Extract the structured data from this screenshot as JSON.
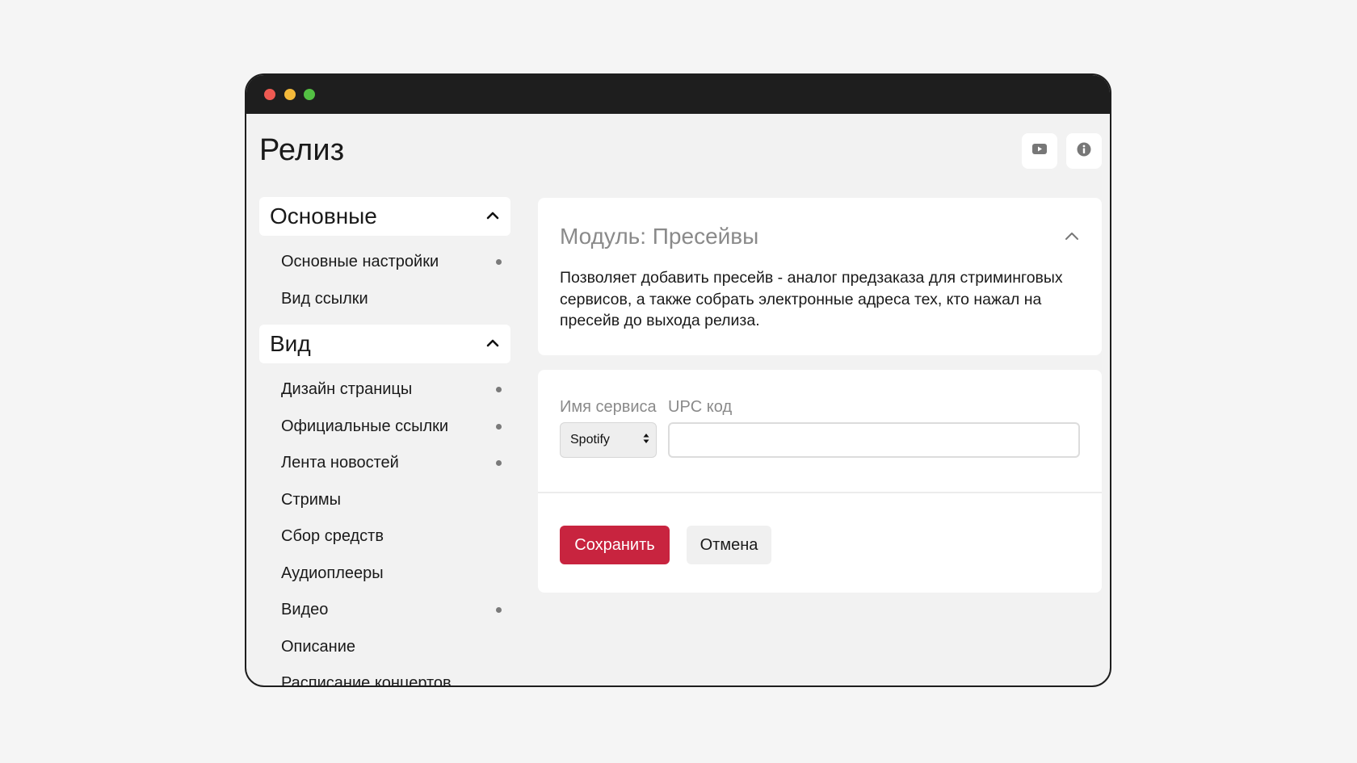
{
  "window": {
    "controls": [
      "close",
      "minimize",
      "maximize"
    ]
  },
  "header": {
    "title": "Релиз",
    "icons": [
      "youtube-icon",
      "info-icon"
    ]
  },
  "sidebar": {
    "groups": [
      {
        "title": "Основные",
        "items": [
          {
            "label": "Основные настройки",
            "dot": true
          },
          {
            "label": "Вид ссылки",
            "dot": false
          }
        ]
      },
      {
        "title": "Вид",
        "items": [
          {
            "label": "Дизайн страницы",
            "dot": true
          },
          {
            "label": "Официальные ссылки",
            "dot": true
          },
          {
            "label": "Лента новостей",
            "dot": true
          },
          {
            "label": "Стримы",
            "dot": false
          },
          {
            "label": "Сбор средств",
            "dot": false
          },
          {
            "label": "Аудиоплееры",
            "dot": false
          },
          {
            "label": "Видео",
            "dot": true
          },
          {
            "label": "Описание",
            "dot": false
          },
          {
            "label": "Расписание концертов",
            "dot": false
          }
        ]
      }
    ]
  },
  "module": {
    "title": "Модуль: Пресейвы",
    "description": "Позволяет добавить пресейв - аналог предзаказа для стриминговых сервисов, а также собрать электронные адреса тех, кто нажал на пресейв до выхода релиза."
  },
  "form": {
    "service_label": "Имя сервиса",
    "service_value": "Spotify",
    "upc_label": "UPC код",
    "upc_value": "",
    "save_label": "Сохранить",
    "cancel_label": "Отмена"
  },
  "colors": {
    "accent": "#c8243f",
    "titlebar": "#1e1e1e",
    "background": "#f2f2f2"
  }
}
